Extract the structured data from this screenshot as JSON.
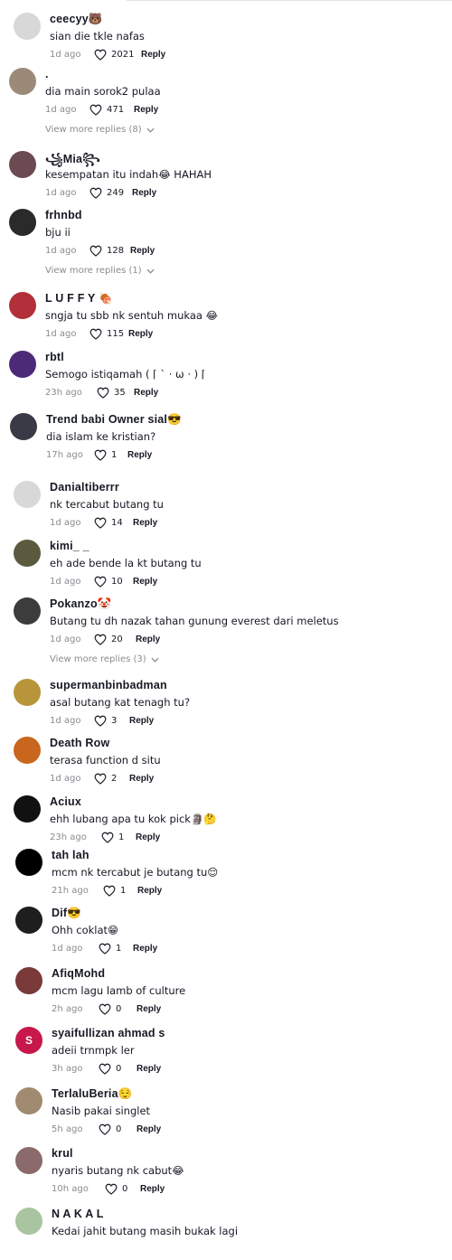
{
  "colors": {
    "text": "#161823",
    "muted": "#8a8b91",
    "background": "#ffffff"
  },
  "comments": [
    {
      "username": "ceecyy🐻",
      "text": "sian die tkle nafas",
      "time": "1d ago",
      "likes": "2021",
      "reply": "Reply",
      "avatar_color": "#d8d8d8",
      "avatar_initial": ""
    },
    {
      "username": ".",
      "text": "dia main sorok2 pulaa",
      "time": "1d ago",
      "likes": "471",
      "reply": "Reply",
      "avatar_color": "#9c8a78",
      "avatar_initial": "",
      "view_more": "View more replies (8)"
    },
    {
      "username": "꧁Mia꧂",
      "text": "kesempatan itu indah😂 HAHAH",
      "time": "1d ago",
      "likes": "249",
      "reply": "Reply",
      "avatar_color": "#6b4a52",
      "avatar_initial": ""
    },
    {
      "username": "frhnbd",
      "text": "bju ii",
      "time": "1d ago",
      "likes": "128",
      "reply": "Reply",
      "avatar_color": "#2a2a2a",
      "avatar_initial": "",
      "view_more": "View more replies (1)"
    },
    {
      "username": "L U F F Y 🍖",
      "text": "sngja tu sbb nk sentuh mukaa 😂",
      "time": "1d ago",
      "likes": "115",
      "reply": "Reply",
      "avatar_color": "#b2303a",
      "avatar_initial": ""
    },
    {
      "username": "rbtl",
      "text": "Semogo istiqamah ( ⌈ ˋ · ω · ) ⌈",
      "time": "23h ago",
      "likes": "35",
      "reply": "Reply",
      "avatar_color": "#4b2a78",
      "avatar_initial": ""
    },
    {
      "username": "Trend babi Owner sial😎",
      "text": "dia islam ke kristian?",
      "time": "17h ago",
      "likes": "1",
      "reply": "Reply",
      "avatar_color": "#3a3a46",
      "avatar_initial": ""
    },
    {
      "username": "Danialtiberrr",
      "text": "nk tercabut butang tu",
      "time": "1d ago",
      "likes": "14",
      "reply": "Reply",
      "avatar_color": "#d8d8d8",
      "avatar_initial": ""
    },
    {
      "username": "kimi_ _",
      "text": "eh ade bende la kt butang tu",
      "time": "1d ago",
      "likes": "10",
      "reply": "Reply",
      "avatar_color": "#5c5a3e",
      "avatar_initial": ""
    },
    {
      "username": "Pokanzo🤡",
      "text": "Butang tu dh nazak tahan gunung everest dari meletus",
      "time": "1d ago",
      "likes": "20",
      "reply": "Reply",
      "avatar_color": "#3c3c3c",
      "avatar_initial": "",
      "view_more": "View more replies (3)"
    },
    {
      "username": "supermanbinbadman",
      "text": "asal butang kat tenagh tu?",
      "time": "1d ago",
      "likes": "3",
      "reply": "Reply",
      "avatar_color": "#b8953a",
      "avatar_initial": ""
    },
    {
      "username": "Death Row",
      "text": "terasa function d situ",
      "time": "1d ago",
      "likes": "2",
      "reply": "Reply",
      "avatar_color": "#c8661e",
      "avatar_initial": ""
    },
    {
      "username": "Aciux",
      "text": "ehh lubang apa tu kok pick🗿🤔",
      "time": "23h ago",
      "likes": "1",
      "reply": "Reply",
      "avatar_color": "#111111",
      "avatar_initial": ""
    },
    {
      "username": "tah lah",
      "text": "mcm nk tercabut je butang tu😌",
      "time": "21h ago",
      "likes": "1",
      "reply": "Reply",
      "avatar_color": "#000000",
      "avatar_initial": ""
    },
    {
      "username": "Dif😎",
      "text": "Ohh coklat😁",
      "time": "1d ago",
      "likes": "1",
      "reply": "Reply",
      "avatar_color": "#1e1e1e",
      "avatar_initial": ""
    },
    {
      "username": "AfiqMohd",
      "text": "mcm lagu lamb of culture",
      "time": "2h ago",
      "likes": "0",
      "reply": "Reply",
      "avatar_color": "#7a3a3a",
      "avatar_initial": ""
    },
    {
      "username": "syaifullizan ahmad s",
      "text": "adeii trnmpk ler",
      "time": "3h ago",
      "likes": "0",
      "reply": "Reply",
      "avatar_color": "#c8174a",
      "avatar_initial": "S"
    },
    {
      "username": "TerlaluBeria😌",
      "text": "Nasib pakai singlet",
      "time": "5h ago",
      "likes": "0",
      "reply": "Reply",
      "avatar_color": "#a08b70",
      "avatar_initial": ""
    },
    {
      "username": "krul",
      "text": "nyaris butang nk cabut😂",
      "time": "10h ago",
      "likes": "0",
      "reply": "Reply",
      "avatar_color": "#8a6a6a",
      "avatar_initial": ""
    },
    {
      "username": "N A K A L",
      "text": "Kedai jahit butang masih bukak lagi",
      "time": "",
      "likes": "",
      "reply": "",
      "avatar_color": "#a8c4a0",
      "avatar_initial": ""
    }
  ]
}
